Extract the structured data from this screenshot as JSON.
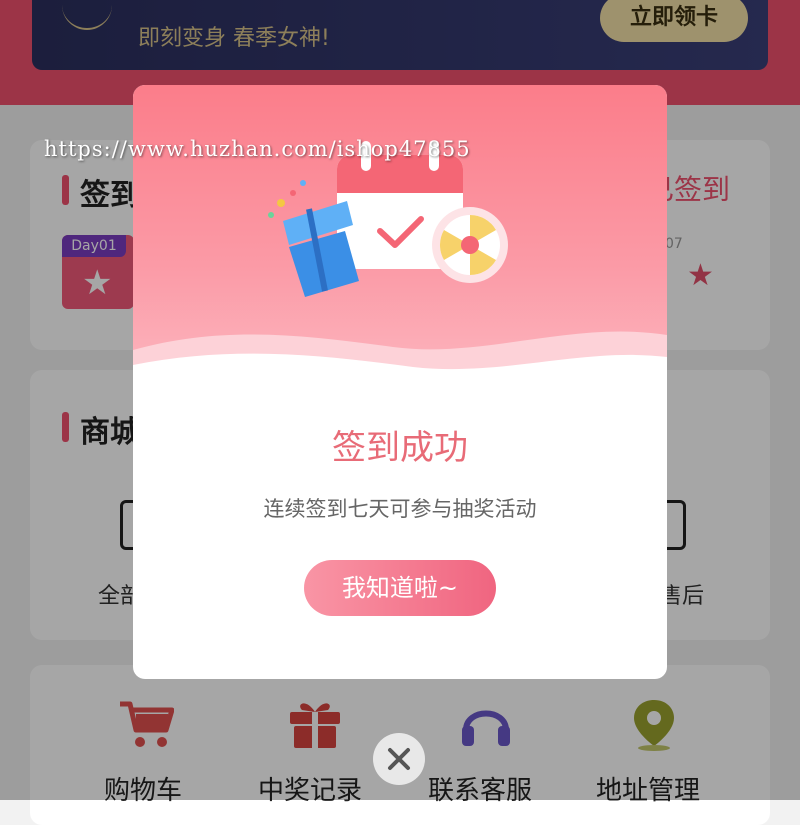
{
  "vip_banner": {
    "subtitle": "即刻变身 春季女神!",
    "cta_label": "立即领卡"
  },
  "signin_section": {
    "title": "签到",
    "status": "已签到",
    "days": [
      {
        "label": "Day01",
        "state": "signed"
      },
      {
        "label": "07",
        "state": "unsigned"
      }
    ]
  },
  "mall_section": {
    "title": "商城",
    "items": [
      {
        "label": "全部"
      },
      {
        "label": "售后"
      }
    ]
  },
  "tools": [
    {
      "label": "购物车",
      "icon": "cart-icon",
      "color": "#e0514f"
    },
    {
      "label": "中奖记录",
      "icon": "gift-icon",
      "color": "#d8443f"
    },
    {
      "label": "联系客服",
      "icon": "headset-icon",
      "color": "#6a58c9"
    },
    {
      "label": "地址管理",
      "icon": "map-pin-icon",
      "color": "#9aa12e"
    }
  ],
  "watermark": "https://www.huzhan.com/ishop47855",
  "modal": {
    "title": "签到成功",
    "description": "连续签到七天可参与抽奖活动",
    "confirm_label": "我知道啦~",
    "close_icon": "close-icon"
  },
  "colors": {
    "accent": "#f0506e",
    "modal_title": "#e86b77",
    "modal_header": "#fb7d8a"
  }
}
